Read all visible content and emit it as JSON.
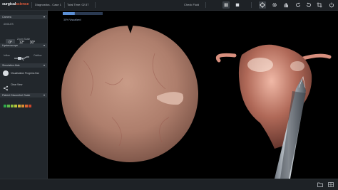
{
  "app": {
    "logo_text": "surgical",
    "logo_accent": "science"
  },
  "topbar": {
    "module": "Diagnostics - Case 1",
    "total_time": "Total Time: 02:37",
    "check_fluid": "Check Fluid",
    "icons": [
      "pause-icon",
      "stop-icon",
      "crosshair-icon",
      "settings-cog-icon",
      "hand-icon",
      "rotate-icon",
      "reset-icon",
      "crop-icon",
      "power-icon"
    ]
  },
  "sidebar": {
    "camera": {
      "header": "Camera",
      "angles_label": "ANGLES",
      "angles": [
        "0°",
        "12°",
        "30°"
      ],
      "selected_index": 0,
      "zoom_label": "Zoom Scale"
    },
    "hysteroscope": {
      "header": "Hysteroscope",
      "inflow_label": "Inflow",
      "outflow_label": "Outflow"
    },
    "simulation_aids": {
      "header": "Simulation Aids",
      "items": [
        {
          "icon": "visualization-icon",
          "label": "Visualization Progress Bar"
        },
        {
          "icon": "share-icon",
          "label": "Clear View"
        }
      ]
    },
    "distension": {
      "header": "Patient Discomfort Scale",
      "colors": [
        "#2ea84a",
        "#5cb84a",
        "#8dc03e",
        "#b8c43a",
        "#d6b33a",
        "#d98e34",
        "#d8632f",
        "#c8452c"
      ]
    }
  },
  "main": {
    "progress_label": "30% Visualized",
    "progress_value": 0.3
  },
  "bottombar": {
    "icons": [
      "folder-icon",
      "grid-icon"
    ]
  },
  "colors": {
    "accent": "#e05a3a",
    "progress": "#5b8fd6"
  }
}
